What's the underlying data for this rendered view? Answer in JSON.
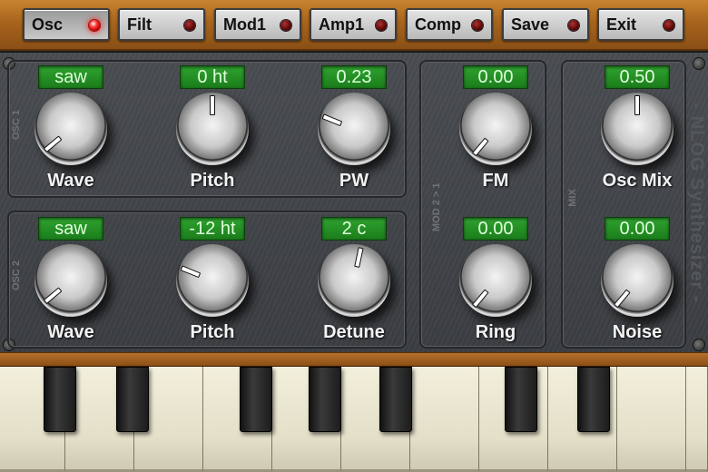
{
  "toolbar": {
    "buttons": [
      {
        "label": "Osc",
        "active": true
      },
      {
        "label": "Filt",
        "active": false
      },
      {
        "label": "Mod1",
        "active": false
      },
      {
        "label": "Amp1",
        "active": false
      },
      {
        "label": "Comp",
        "active": false
      },
      {
        "label": "Save",
        "active": false
      },
      {
        "label": "Exit",
        "active": false
      }
    ]
  },
  "sections": {
    "osc1": {
      "label": "OSC 1"
    },
    "osc2": {
      "label": "OSC 2"
    },
    "mod": {
      "label": "MOD 2 > 1"
    },
    "mix": {
      "label": "MIX"
    }
  },
  "brand": "- NLOG Synthesizer -",
  "osc1": {
    "wave": {
      "display": "saw",
      "label": "Wave"
    },
    "pitch": {
      "display": "0 ht",
      "label": "Pitch"
    },
    "pw": {
      "display": "0.23",
      "label": "PW"
    }
  },
  "osc2": {
    "wave": {
      "display": "saw",
      "label": "Wave"
    },
    "pitch": {
      "display": "-12 ht",
      "label": "Pitch"
    },
    "detune": {
      "display": "2 c",
      "label": "Detune"
    }
  },
  "mod": {
    "fm": {
      "display": "0.00",
      "label": "FM"
    },
    "ring": {
      "display": "0.00",
      "label": "Ring"
    }
  },
  "mix": {
    "osc_mix": {
      "display": "0.50",
      "label": "Osc Mix"
    },
    "noise": {
      "display": "0.00",
      "label": "Noise"
    }
  },
  "colors": {
    "wood": "#a8641c",
    "panel": "#3f4246",
    "display_green": "#22922a",
    "led_on": "#ff3b3b",
    "led_off": "#5a0707"
  }
}
